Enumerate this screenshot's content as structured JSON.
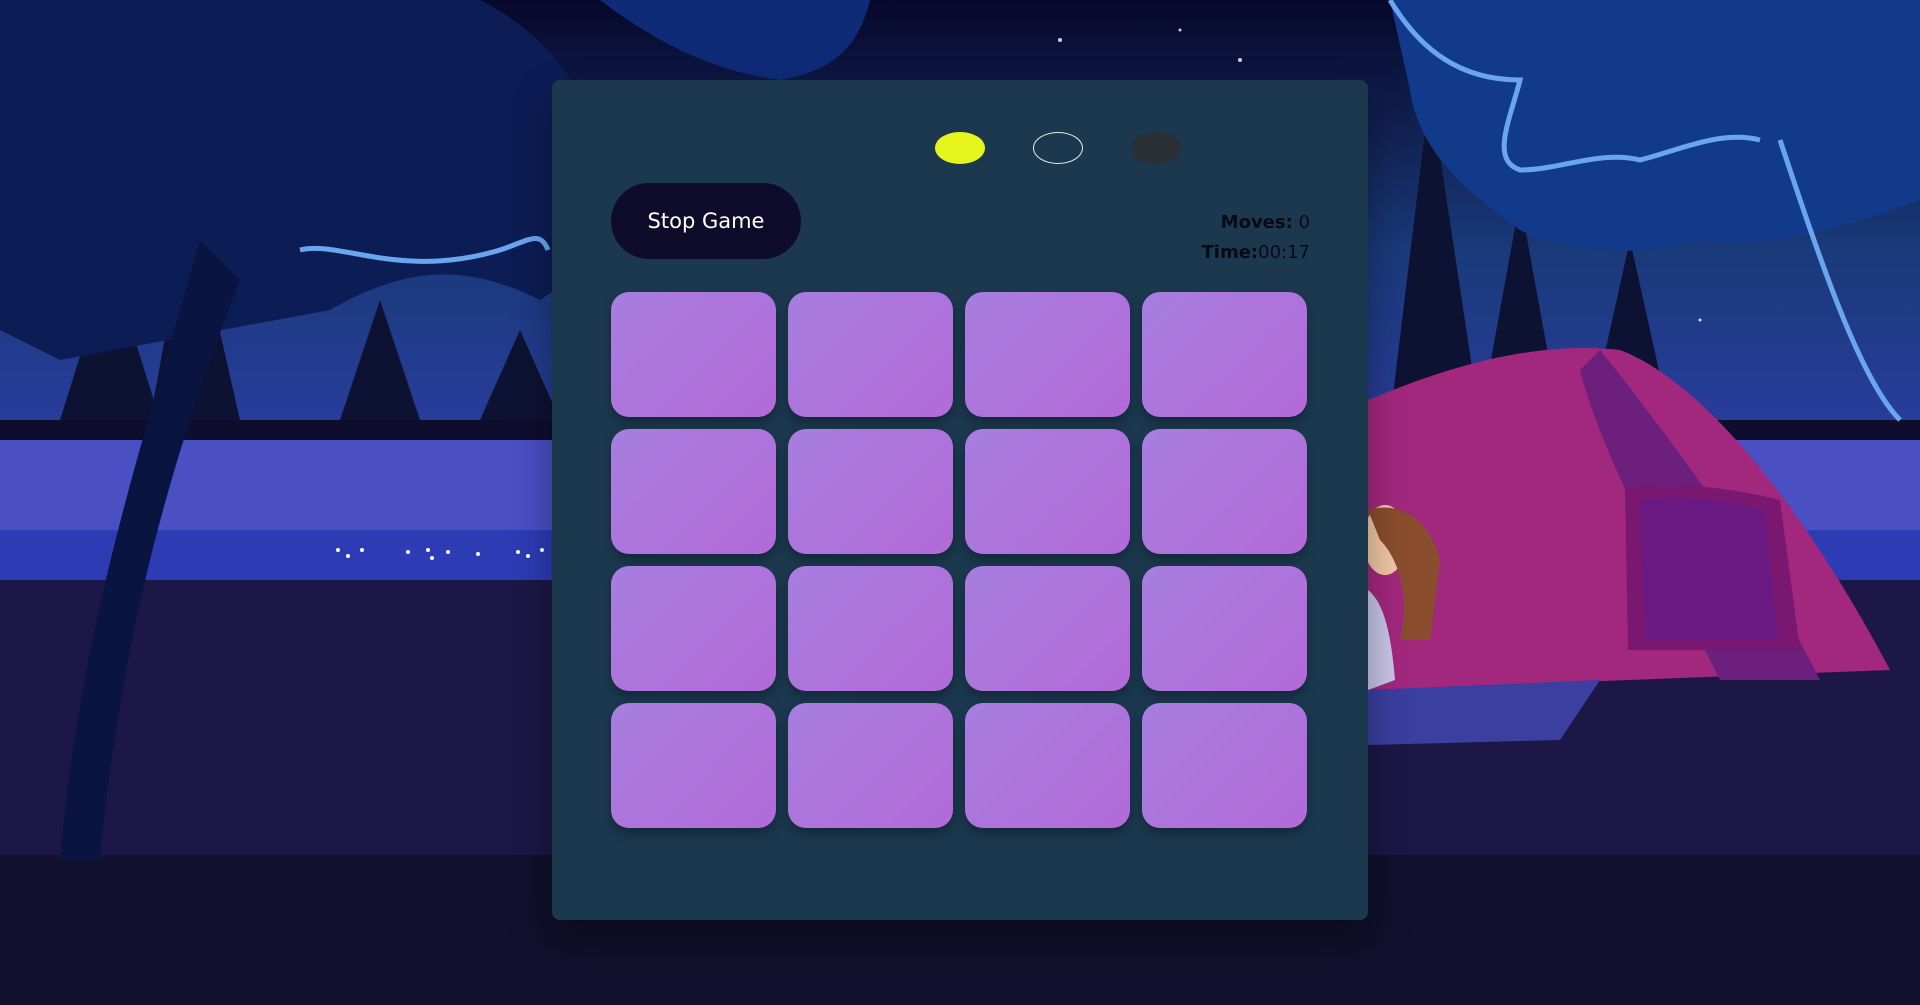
{
  "game": {
    "stop_label": "Stop Game",
    "moves_label": "Moves:",
    "moves_value": "0",
    "time_label": "Time:",
    "time_value": "00:17",
    "indicators": [
      "yellow",
      "outline",
      "dark"
    ],
    "card_count": 16
  },
  "colors": {
    "panel": "#1b384f",
    "card_start": "#a77ee0",
    "card_end": "#b36ad8",
    "indicator_active": "#e6f51c",
    "button_bg": "#0f0c2b"
  }
}
